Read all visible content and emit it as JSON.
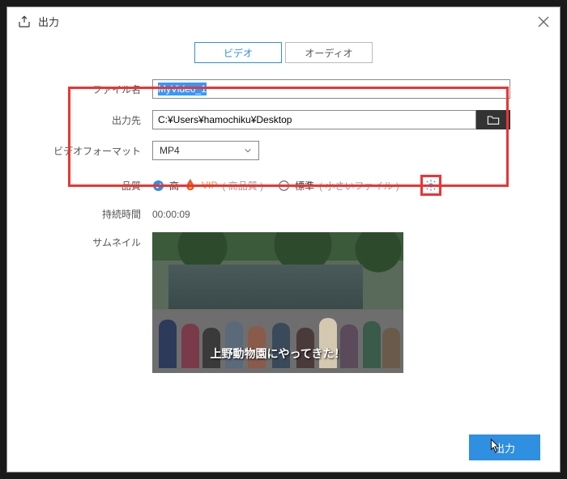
{
  "titlebar": {
    "title": "出力"
  },
  "tabs": {
    "video": "ビデオ",
    "audio": "オーディオ"
  },
  "labels": {
    "filename": "ファイル名",
    "output_to": "出力先",
    "video_format": "ビデオフォーマット",
    "quality": "品質",
    "duration": "持続時間",
    "thumbnail": "サムネイル"
  },
  "filename": {
    "value": "MyVideo_1"
  },
  "output_path": {
    "value": "C:¥Users¥hamochiku¥Desktop"
  },
  "format": {
    "selected": "MP4"
  },
  "quality": {
    "high_label": "高",
    "vip_label": "VIP",
    "high_note": "( 高品質 )",
    "std_label": "標準",
    "std_note": "( 小さいファイル )"
  },
  "duration": {
    "value": "00:00:09"
  },
  "thumbnail": {
    "subtitle": "上野動物園にやってきた！"
  },
  "footer": {
    "output": "出力"
  },
  "colors": {
    "accent": "#2f8fe0",
    "highlight": "#e33"
  }
}
